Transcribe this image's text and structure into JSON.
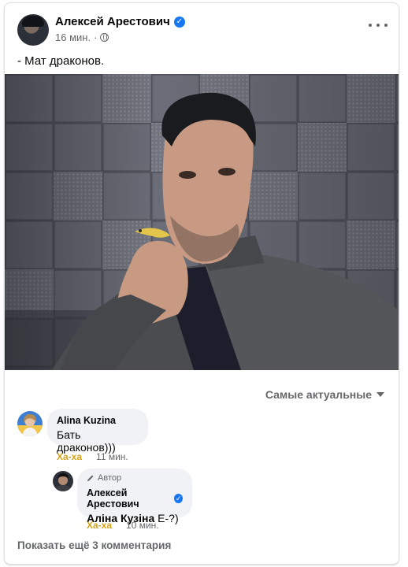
{
  "post": {
    "author": "Алексей Арестович",
    "time": "16 мин.",
    "dot": "·",
    "text": "- Мат драконов.",
    "more_icon": "more-horizontal-icon",
    "privacy_icon": "globe-icon",
    "verified_icon": "verified-check-icon"
  },
  "comments": {
    "sort_label": "Самые актуальные",
    "items": [
      {
        "author": "Alina Kuzina",
        "text": "Бать драконов)))",
        "reaction_label": "Ха-ха",
        "time": "11 мин."
      }
    ],
    "reply": {
      "badge": "Автор",
      "author": "Алексей Арестович",
      "mention": "Аліна Кузіна",
      "text": " Е-?)",
      "reaction_label": "Ха-ха",
      "time": "10 мин."
    },
    "show_more": "Показать ещё 3 комментария"
  },
  "colors": {
    "accent": "#1877f2",
    "haha": "#d5a31a",
    "bubble": "#f0f2f5",
    "secondary_text": "#65676b"
  }
}
